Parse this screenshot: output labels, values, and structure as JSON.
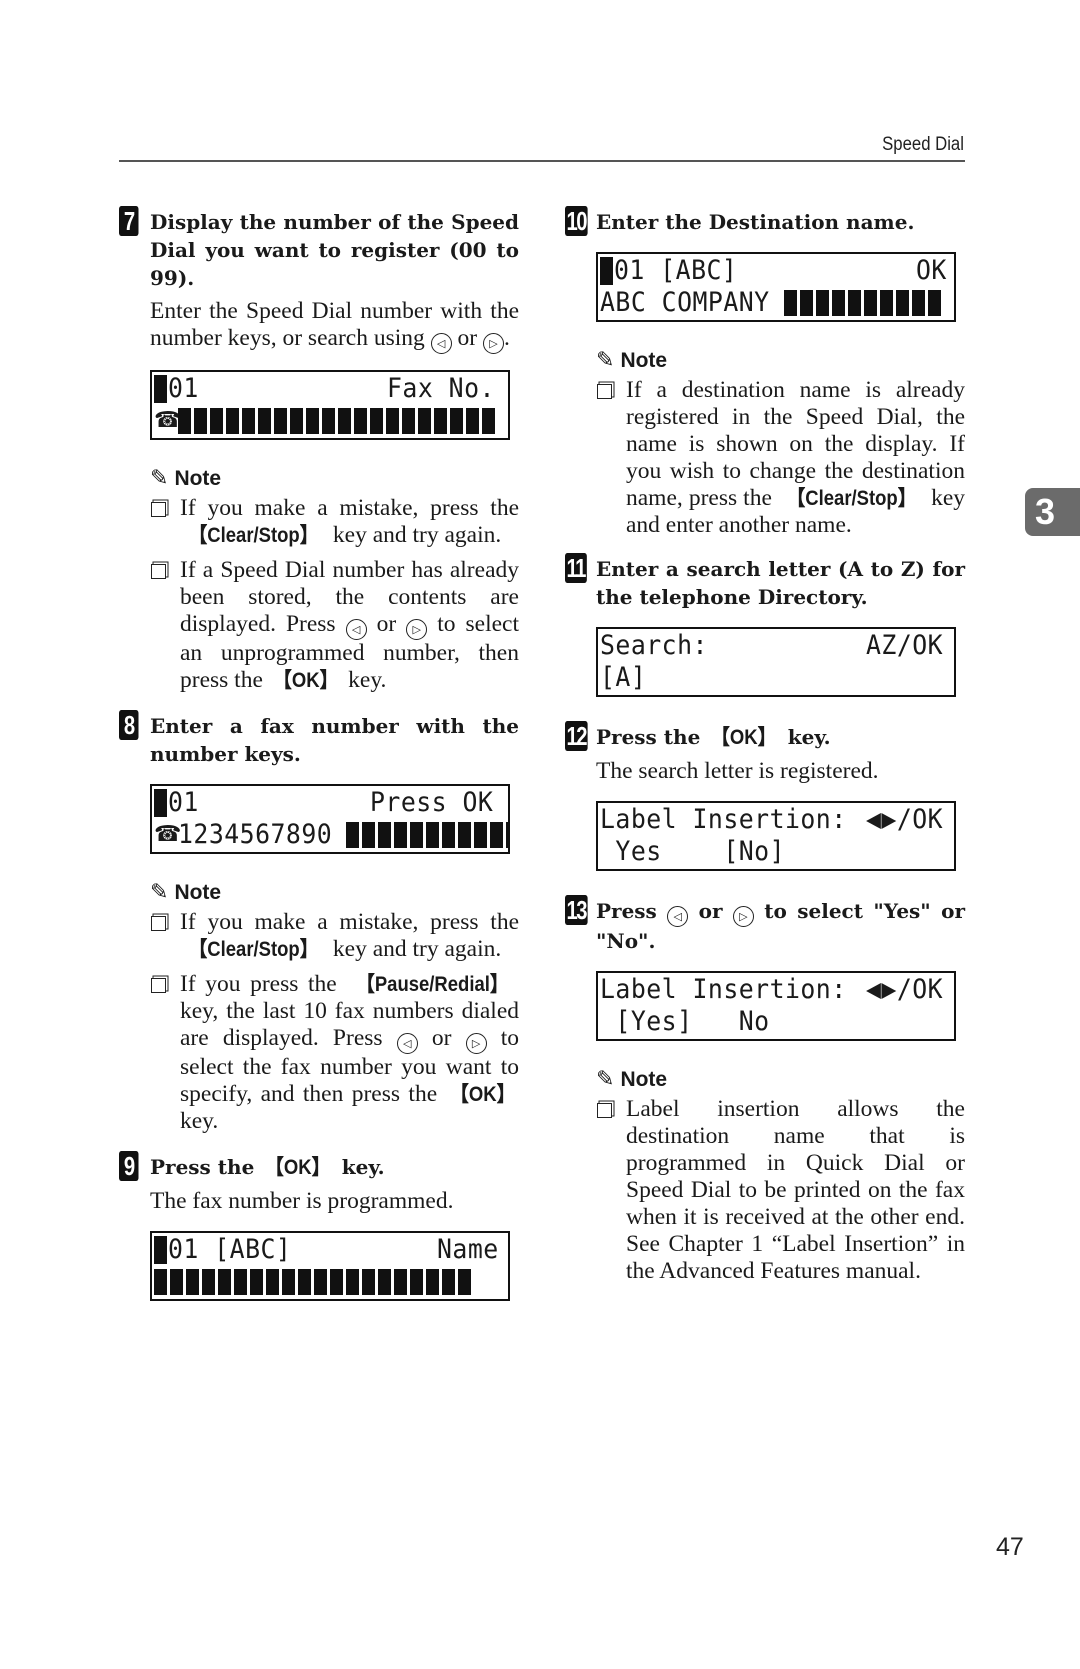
{
  "header": {
    "section_title": "Speed Dial"
  },
  "chapter_tab": "3",
  "page_number": "47",
  "icons": {
    "left_arrow": "◁",
    "right_arrow": "▷",
    "pencil": "✎",
    "phone": "☎"
  },
  "steps": {
    "s7": {
      "number": "7",
      "title": "Display the number of the Speed Dial you want to register (00 to 99).",
      "body_pre": "Enter the Speed Dial number with the number keys, or search using",
      "body_mid": "or",
      "body_post": ".",
      "lcd": {
        "r1_left": "01",
        "r1_right": "Fax No.",
        "r2_text": "",
        "r2_blocks": 20
      },
      "note_label": "Note",
      "notes": [
        {
          "pre": "If you make a mistake, press the",
          "key": "【Clear/Stop】",
          "post": "key and try again."
        },
        {
          "pre": "If a Speed Dial number has already been stored, the contents are displayed. Press",
          "mid1": "or",
          "mid2": "to select an unprogrammed number, then press the",
          "key": "【OK】",
          "post": "key."
        }
      ]
    },
    "s8": {
      "number": "8",
      "title": "Enter a fax number with the number keys.",
      "lcd": {
        "r1_left": "01",
        "r1_right": "Press OK",
        "r2_text": "1234567890",
        "r2_blocks": 11
      },
      "note_label": "Note",
      "notes": [
        {
          "pre": "If you make a mistake, press the",
          "key": "【Clear/Stop】",
          "post": "key and try again."
        },
        {
          "pre": "If you press the",
          "key": "【Pause/Redial】",
          "mid": "key, the last 10 fax numbers dialed are displayed. Press",
          "mid1": "or",
          "mid2": "to select the fax number you want to specify, and then press the",
          "key2": "【OK】",
          "post": "key."
        }
      ]
    },
    "s9": {
      "number": "9",
      "title_pre": "Press the",
      "title_key": "【OK】",
      "title_post": "key.",
      "body": "The fax number is programmed.",
      "lcd": {
        "r1_left": "01 [ABC]",
        "r1_right": "Name",
        "r2_blocks": 20
      }
    },
    "s10": {
      "number": "10",
      "title": "Enter the Destination name.",
      "lcd": {
        "r1_left": "01 [ABC]",
        "r1_right": "OK",
        "r2_text": "ABC COMPANY",
        "r2_blocks": 10
      },
      "note_label": "Note",
      "notes": [
        {
          "pre": "If a destination name is already registered in the Speed Dial, the name is shown on the display. If you wish to change the destination name, press the",
          "key": "【Clear/Stop】",
          "post": "key and enter another name."
        }
      ]
    },
    "s11": {
      "number": "11",
      "title": "Enter a search letter (A to Z) for the telephone Directory.",
      "lcd": {
        "r1_left": "Search:",
        "r1_right": "AZ/OK",
        "r2_text": "[A]"
      }
    },
    "s12": {
      "number": "12",
      "title_pre": "Press the",
      "title_key": "【OK】",
      "title_post": "key.",
      "body": "The search letter is registered.",
      "lcd": {
        "r1_left": "Label Insertion:",
        "r1_right": "◀▶/OK",
        "r2_text": " Yes    [No]"
      }
    },
    "s13": {
      "number": "13",
      "title_pre": "Press",
      "title_mid": "or",
      "title_post": "to select \"Yes\" or \"No\".",
      "lcd": {
        "r1_left": "Label Insertion:",
        "r1_right": "◀▶/OK",
        "r2_text": " [Yes]   No"
      },
      "note_label": "Note",
      "notes": [
        {
          "text": "Label insertion allows the destination name that is programmed in Quick Dial or Speed Dial to be printed on the fax when it is received at the other end. See Chapter 1 “Label Insertion” in the Advanced Features manual."
        }
      ]
    }
  }
}
